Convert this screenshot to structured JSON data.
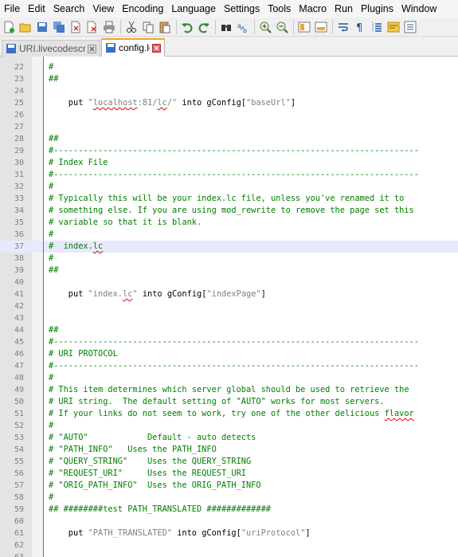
{
  "menu": [
    "File",
    "Edit",
    "Search",
    "View",
    "Encoding",
    "Language",
    "Settings",
    "Tools",
    "Macro",
    "Run",
    "Plugins",
    "Window"
  ],
  "toolbar": {
    "buttons": [
      "new-file-icon",
      "open-file-icon",
      "save-icon",
      "save-all-icon",
      "close-icon",
      "close-all-icon",
      "print-icon",
      "cut-icon",
      "copy-icon",
      "paste-icon",
      "undo-icon",
      "redo-icon",
      "find-icon",
      "replace-icon",
      "zoom-in-icon",
      "zoom-out-icon",
      "sync-vertical-icon",
      "sync-horizontal-icon",
      "word-wrap-icon",
      "show-all-chars-icon",
      "indent-guide-icon",
      "document-map-icon",
      "function-list-icon"
    ]
  },
  "tabs": [
    {
      "label": "URI.livecodescript",
      "active": false
    },
    {
      "label": "config.lc",
      "active": true
    }
  ],
  "editor": {
    "highlighted_line": 37,
    "lines": [
      {
        "n": "22",
        "segs": [
          {
            "t": "#",
            "c": "cm"
          }
        ]
      },
      {
        "n": "23",
        "segs": [
          {
            "t": "##",
            "c": "cm"
          }
        ]
      },
      {
        "n": "24",
        "segs": []
      },
      {
        "n": "25",
        "segs": [
          {
            "t": "    put ",
            "c": "p"
          },
          {
            "t": "\"",
            "c": "s"
          },
          {
            "t": "localhost",
            "c": "sq"
          },
          {
            "t": ":81/",
            "c": "s"
          },
          {
            "t": "lc",
            "c": "sq"
          },
          {
            "t": "/\"",
            "c": "s"
          },
          {
            "t": " into gConfig[",
            "c": "p"
          },
          {
            "t": "\"baseUrl\"",
            "c": "s"
          },
          {
            "t": "]",
            "c": "p"
          }
        ]
      },
      {
        "n": "26",
        "segs": []
      },
      {
        "n": "27",
        "segs": []
      },
      {
        "n": "28",
        "segs": [
          {
            "t": "##",
            "c": "cm"
          }
        ]
      },
      {
        "n": "29",
        "segs": [
          {
            "t": "#--------------------------------------------------------------------------",
            "c": "cm"
          }
        ]
      },
      {
        "n": "30",
        "segs": [
          {
            "t": "# Index File",
            "c": "cm"
          }
        ]
      },
      {
        "n": "31",
        "segs": [
          {
            "t": "#--------------------------------------------------------------------------",
            "c": "cm"
          }
        ]
      },
      {
        "n": "32",
        "segs": [
          {
            "t": "#",
            "c": "cm"
          }
        ]
      },
      {
        "n": "33",
        "segs": [
          {
            "t": "# Typically this will be your index.lc file, unless you've renamed it to",
            "c": "cm"
          }
        ]
      },
      {
        "n": "34",
        "segs": [
          {
            "t": "# something else. If you are using mod_rewrite to remove the page set this",
            "c": "cm"
          }
        ]
      },
      {
        "n": "35",
        "segs": [
          {
            "t": "# variable so that it is blank.",
            "c": "cm"
          }
        ]
      },
      {
        "n": "36",
        "segs": [
          {
            "t": "#",
            "c": "cm"
          }
        ]
      },
      {
        "n": "37",
        "segs": [
          {
            "t": "#  index.",
            "c": "cm"
          },
          {
            "t": "lc",
            "c": "sqc"
          }
        ]
      },
      {
        "n": "38",
        "segs": [
          {
            "t": "#",
            "c": "cm"
          }
        ]
      },
      {
        "n": "39",
        "segs": [
          {
            "t": "##",
            "c": "cm"
          }
        ]
      },
      {
        "n": "40",
        "segs": []
      },
      {
        "n": "41",
        "segs": [
          {
            "t": "    put ",
            "c": "p"
          },
          {
            "t": "\"index.",
            "c": "s"
          },
          {
            "t": "lc",
            "c": "sq"
          },
          {
            "t": "\"",
            "c": "s"
          },
          {
            "t": " into gConfig[",
            "c": "p"
          },
          {
            "t": "\"indexPage\"",
            "c": "s"
          },
          {
            "t": "]",
            "c": "p"
          }
        ]
      },
      {
        "n": "42",
        "segs": []
      },
      {
        "n": "43",
        "segs": []
      },
      {
        "n": "44",
        "segs": [
          {
            "t": "##",
            "c": "cm"
          }
        ]
      },
      {
        "n": "45",
        "segs": [
          {
            "t": "#--------------------------------------------------------------------------",
            "c": "cm"
          }
        ]
      },
      {
        "n": "46",
        "segs": [
          {
            "t": "# URI PROTOCOL",
            "c": "cm"
          }
        ]
      },
      {
        "n": "47",
        "segs": [
          {
            "t": "#--------------------------------------------------------------------------",
            "c": "cm"
          }
        ]
      },
      {
        "n": "48",
        "segs": [
          {
            "t": "#",
            "c": "cm"
          }
        ]
      },
      {
        "n": "49",
        "segs": [
          {
            "t": "# This item determines which server global should be used to retrieve the",
            "c": "cm"
          }
        ]
      },
      {
        "n": "50",
        "segs": [
          {
            "t": "# URI string.  The default setting of \"AUTO\" works for most servers.",
            "c": "cm"
          }
        ]
      },
      {
        "n": "51",
        "segs": [
          {
            "t": "# If your links do not seem to work, try one of the other delicious ",
            "c": "cm"
          },
          {
            "t": "flavor",
            "c": "sqc"
          }
        ]
      },
      {
        "n": "52",
        "segs": [
          {
            "t": "#",
            "c": "cm"
          }
        ]
      },
      {
        "n": "53",
        "segs": [
          {
            "t": "# \"AUTO\"            Default - auto detects",
            "c": "cm"
          }
        ]
      },
      {
        "n": "54",
        "segs": [
          {
            "t": "# \"PATH_INFO\"   Uses the PATH_INFO",
            "c": "cm"
          }
        ]
      },
      {
        "n": "55",
        "segs": [
          {
            "t": "# \"QUERY_STRING\"    Uses the QUERY_STRING",
            "c": "cm"
          }
        ]
      },
      {
        "n": "56",
        "segs": [
          {
            "t": "# \"REQUEST_URI\"     Uses the REQUEST_URI",
            "c": "cm"
          }
        ]
      },
      {
        "n": "57",
        "segs": [
          {
            "t": "# \"ORIG_PATH_INFO\"  Uses the ORIG_PATH_INFO",
            "c": "cm"
          }
        ]
      },
      {
        "n": "58",
        "segs": [
          {
            "t": "#",
            "c": "cm"
          }
        ]
      },
      {
        "n": "59",
        "segs": [
          {
            "t": "## ########test PATH_TRANSLATED #############",
            "c": "cm"
          }
        ]
      },
      {
        "n": "60",
        "segs": []
      },
      {
        "n": "61",
        "segs": [
          {
            "t": "    put ",
            "c": "p"
          },
          {
            "t": "\"PATH_TRANSLATED\"",
            "c": "s"
          },
          {
            "t": " into gConfig[",
            "c": "p"
          },
          {
            "t": "\"uriProtocol\"",
            "c": "s"
          },
          {
            "t": "]",
            "c": "p"
          }
        ]
      },
      {
        "n": "62",
        "segs": []
      },
      {
        "n": "63",
        "segs": []
      }
    ]
  }
}
